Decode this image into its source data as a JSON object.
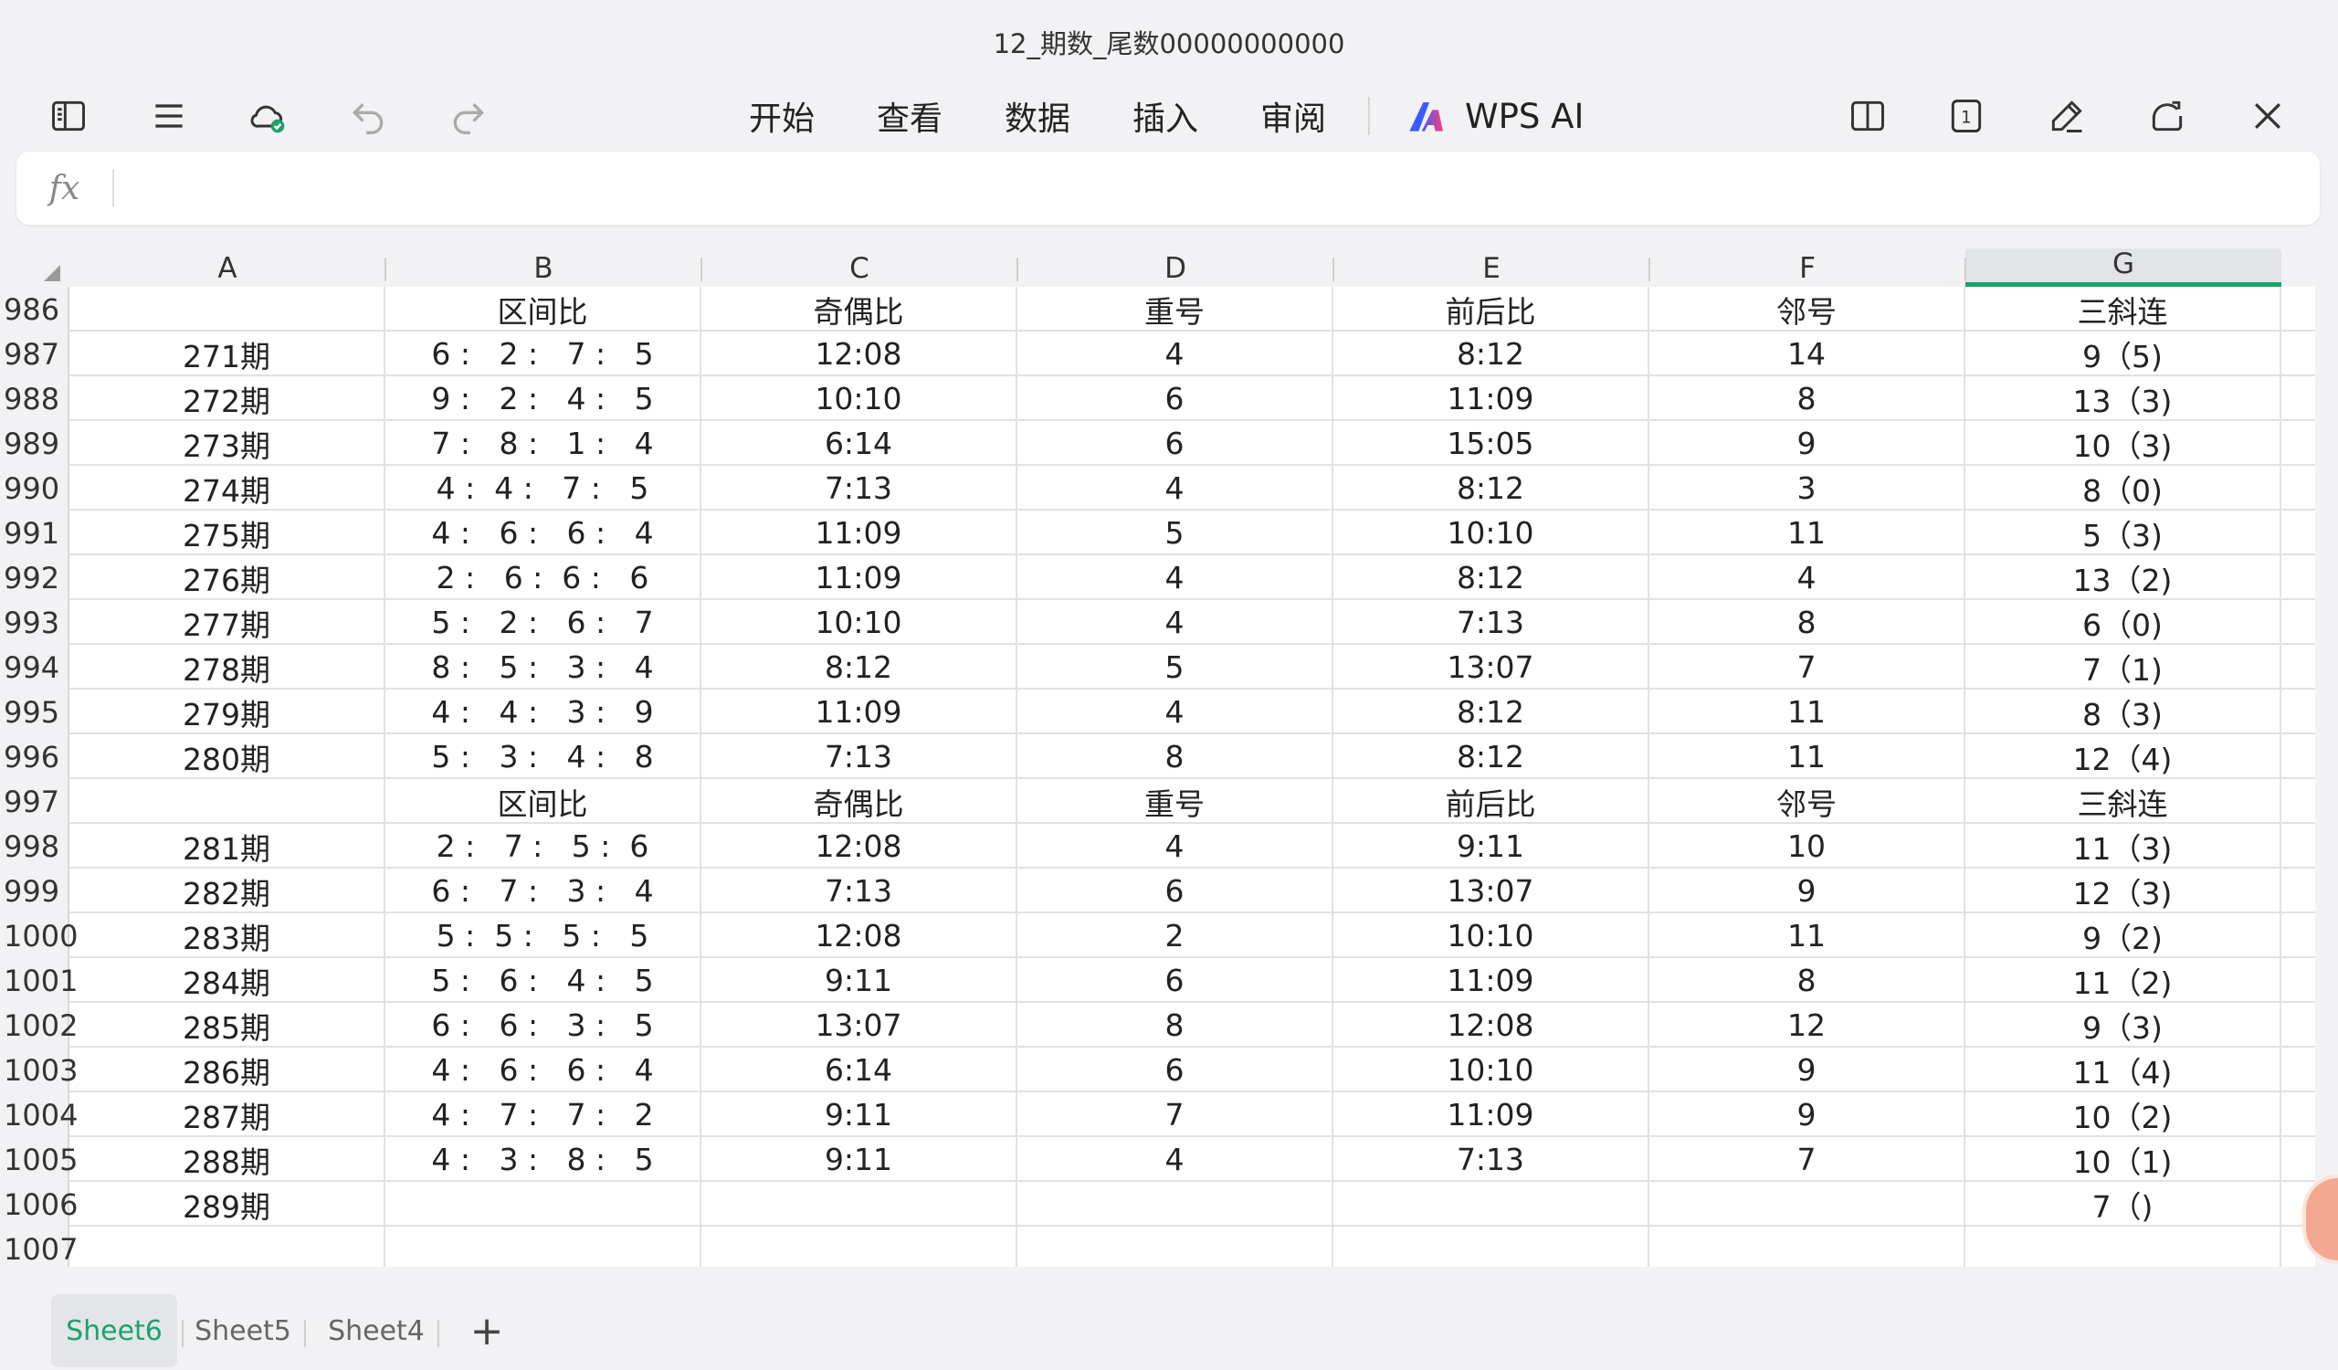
{
  "window": {
    "title": "12_期数_尾数00000000000"
  },
  "toolbar": {
    "menus": [
      "开始",
      "查看",
      "数据",
      "插入",
      "审阅"
    ],
    "ai_label": "WPS AI",
    "page_count_badge": "1",
    "icons": {
      "sidebar": "sidebar-toggle-icon",
      "menu": "hamburger-menu-icon",
      "cloud": "cloud-synced-icon",
      "undo": "undo-icon",
      "redo": "redo-icon",
      "split": "split-view-icon",
      "page": "page-number-icon",
      "edit": "pen-edit-icon",
      "share": "share-icon",
      "close": "close-icon"
    }
  },
  "formula_bar": {
    "fx_label": "fx",
    "value": ""
  },
  "columns": [
    "A",
    "B",
    "C",
    "D",
    "E",
    "F",
    "G"
  ],
  "selected_column": "G",
  "rows": [
    {
      "num": "986",
      "cells": [
        "",
        "区间比",
        "奇偶比",
        "重号",
        "前后比",
        "邻号",
        "三斜连"
      ]
    },
    {
      "num": "987",
      "cells": [
        "271期",
        "6 :   2 :   7 :   5",
        "12:08",
        "4",
        "8:12",
        "14",
        "9（5)"
      ]
    },
    {
      "num": "988",
      "cells": [
        "272期",
        "9 :   2 :   4 :   5",
        "10:10",
        "6",
        "11:09",
        "8",
        "13（3)"
      ]
    },
    {
      "num": "989",
      "cells": [
        "273期",
        "7 :   8 :   1 :   4",
        "6:14",
        "6",
        "15:05",
        "9",
        "10（3)"
      ]
    },
    {
      "num": "990",
      "cells": [
        "274期",
        "4 :  4 :   7 :   5",
        "7:13",
        "4",
        "8:12",
        "3",
        "8（0)"
      ]
    },
    {
      "num": "991",
      "cells": [
        "275期",
        "4 :   6 :   6 :   4",
        "11:09",
        "5",
        "10:10",
        "11",
        "5（3)"
      ]
    },
    {
      "num": "992",
      "cells": [
        "276期",
        "2 :   6 :  6 :   6",
        "11:09",
        "4",
        "8:12",
        "4",
        "13（2)"
      ]
    },
    {
      "num": "993",
      "cells": [
        "277期",
        "5 :   2 :   6 :   7",
        "10:10",
        "4",
        "7:13",
        "8",
        "6（0)"
      ]
    },
    {
      "num": "994",
      "cells": [
        "278期",
        "8 :   5 :   3 :   4",
        "8:12",
        "5",
        "13:07",
        "7",
        "7（1)"
      ]
    },
    {
      "num": "995",
      "cells": [
        "279期",
        "4 :   4 :   3 :   9",
        "11:09",
        "4",
        "8:12",
        "11",
        "8（3)"
      ]
    },
    {
      "num": "996",
      "cells": [
        "280期",
        "5 :   3 :   4 :   8",
        "7:13",
        "8",
        "8:12",
        "11",
        "12（4)"
      ]
    },
    {
      "num": "997",
      "cells": [
        "",
        "区间比",
        "奇偶比",
        "重号",
        "前后比",
        "邻号",
        "三斜连"
      ]
    },
    {
      "num": "998",
      "cells": [
        "281期",
        "2 :   7 :   5 :  6",
        "12:08",
        "4",
        "9:11",
        "10",
        "11（3)"
      ]
    },
    {
      "num": "999",
      "cells": [
        "282期",
        "6 :   7 :   3 :   4",
        "7:13",
        "6",
        "13:07",
        "9",
        "12（3)"
      ]
    },
    {
      "num": "1000",
      "cells": [
        "283期",
        "5 :  5 :   5 :   5",
        "12:08",
        "2",
        "10:10",
        "11",
        "9（2)"
      ]
    },
    {
      "num": "1001",
      "cells": [
        "284期",
        "5 :   6 :   4 :   5",
        "9:11",
        "6",
        "11:09",
        "8",
        "11（2)"
      ]
    },
    {
      "num": "1002",
      "cells": [
        "285期",
        "6 :   6 :   3 :   5",
        "13:07",
        "8",
        "12:08",
        "12",
        "9（3)"
      ]
    },
    {
      "num": "1003",
      "cells": [
        "286期",
        "4 :   6 :   6 :   4",
        "6:14",
        "6",
        "10:10",
        "9",
        "11（4)"
      ]
    },
    {
      "num": "1004",
      "cells": [
        "287期",
        "4 :   7 :   7 :   2",
        "9:11",
        "7",
        "11:09",
        "9",
        "10（2)"
      ]
    },
    {
      "num": "1005",
      "cells": [
        "288期",
        "4 :   3 :   8 :   5",
        "9:11",
        "4",
        "7:13",
        "7",
        "10（1)"
      ]
    },
    {
      "num": "1006",
      "cells": [
        "289期",
        "",
        "",
        "",
        "",
        "",
        "7（)"
      ]
    },
    {
      "num": "1007",
      "cells": [
        "",
        "",
        "",
        "",
        "",
        "",
        ""
      ]
    }
  ],
  "sheets": [
    {
      "label": "Sheet6",
      "active": true
    },
    {
      "label": "Sheet5",
      "active": false
    },
    {
      "label": "Sheet4",
      "active": false
    }
  ],
  "add_sheet_label": "+",
  "colors": {
    "accent": "#1aa36c",
    "ai_gradient_start": "#3b5bff",
    "ai_gradient_end": "#ff3d7f"
  }
}
